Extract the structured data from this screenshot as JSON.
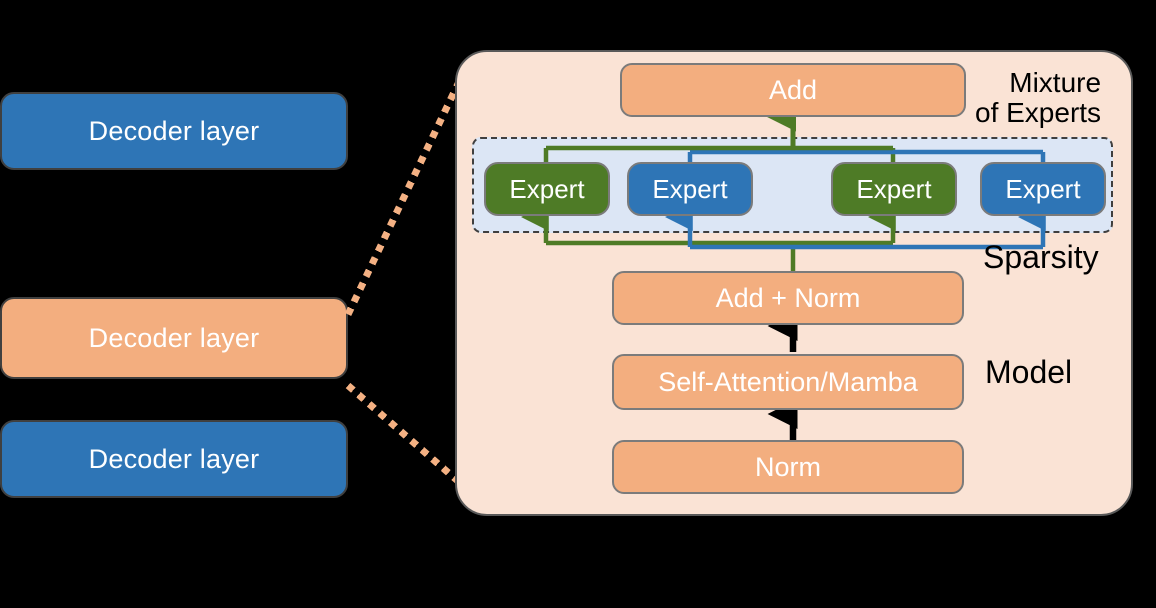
{
  "figure": {
    "title": "Mixture-of-Experts decoder layer diagram",
    "background": "#000000"
  },
  "colors": {
    "panel_fill": "#FAE3D5",
    "panel_border": "#595959",
    "sparsity_fill": "#DCE6F5",
    "sparsity_border": "#3F3F3F",
    "orange": "#F3AE7F",
    "blue": "#2E75B6",
    "green": "#4E7B26",
    "node_border": "#7B7B7B",
    "dotted_connector": "#F4B183",
    "arrow_black": "#000000",
    "text_on_node": "#FFFFFF",
    "text_label": "#000000"
  },
  "left_stack": {
    "items": [
      {
        "label": "Decoder layer",
        "color": "#2E75B6",
        "highlighted": false
      },
      {
        "label": "Decoder layer",
        "color": "#F3AE7F",
        "highlighted": true
      },
      {
        "label": "Decoder layer",
        "color": "#2E75B6",
        "highlighted": false
      }
    ]
  },
  "panel": {
    "annotations": {
      "mixture_of_experts_line1": "Mixture",
      "mixture_of_experts_line2": "of Experts",
      "sparsity": "Sparsity",
      "model": "Model"
    },
    "nodes": {
      "add": "Add",
      "add_norm": "Add + Norm",
      "attention": "Self-Attention/Mamba",
      "norm": "Norm"
    },
    "experts": [
      {
        "label": "Expert",
        "route": "green"
      },
      {
        "label": "Expert",
        "route": "blue"
      },
      {
        "label": "Expert",
        "route": "green"
      },
      {
        "label": "Expert",
        "route": "blue"
      }
    ]
  }
}
